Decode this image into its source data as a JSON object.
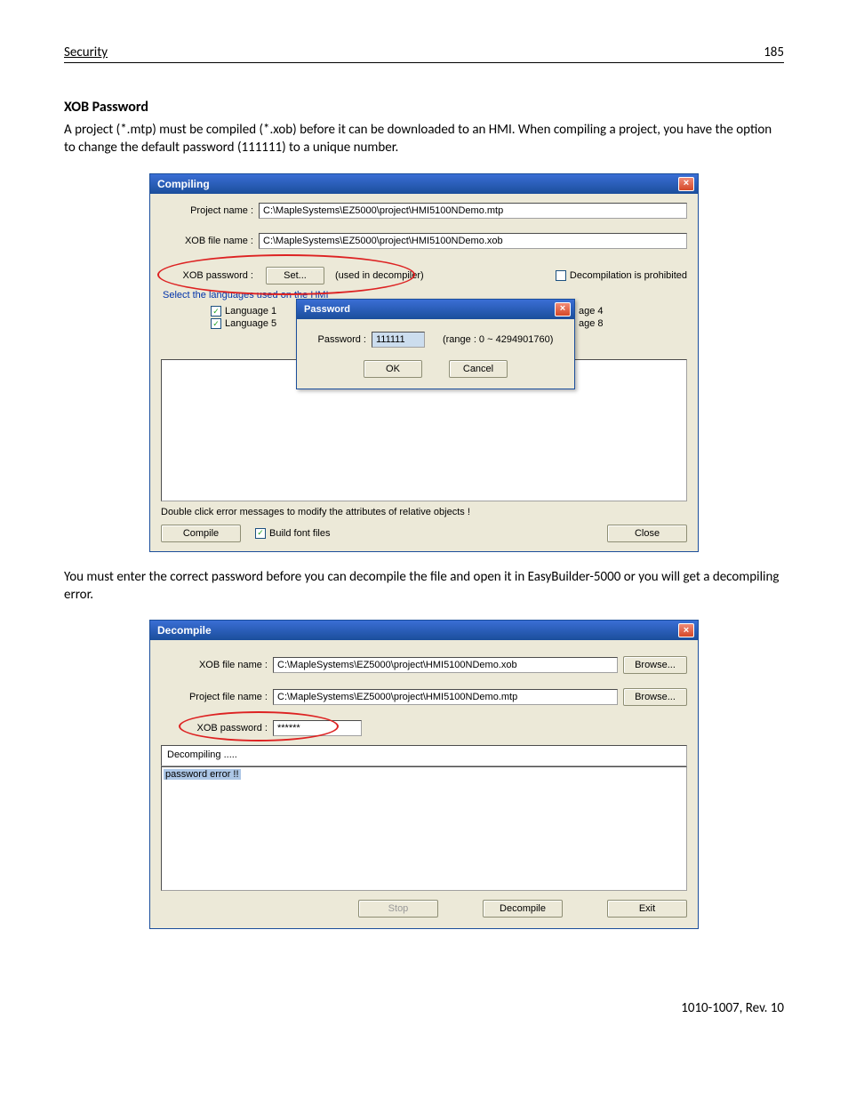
{
  "header": {
    "left": "Security",
    "right": "185"
  },
  "section_title": "XOB Password",
  "para1": "A project (*.mtp) must be compiled (*.xob) before it can be downloaded to an HMI. When compiling a project, you have the option to change the default password (111111) to a unique number.",
  "compiling": {
    "title": "Compiling",
    "project_label": "Project name :",
    "project_value": "C:\\MapleSystems\\EZ5000\\project\\HMI5100NDemo.mtp",
    "xob_label": "XOB file name :",
    "xob_value": "C:\\MapleSystems\\EZ5000\\project\\HMI5100NDemo.xob",
    "pw_label": "XOB password :",
    "set_btn": "Set...",
    "used_note": "(used in decompiler)",
    "prohibit_label": "Decompilation is prohibited",
    "lang_section": "Select the languages used on the HMI",
    "lang1": "Language 1",
    "lang5": "Language 5",
    "lang4_tail": "age 4",
    "lang8_tail": "age 8",
    "dblclick_note": "Double click error messages to modify the attributes of relative objects !",
    "compile_btn": "Compile",
    "build_fonts": "Build font files",
    "close_btn": "Close",
    "pw_dialog": {
      "title": "Password",
      "pw_label": "Password :",
      "pw_value": "111111",
      "range_note": "(range : 0 ~ 4294901760)",
      "ok": "OK",
      "cancel": "Cancel"
    }
  },
  "para2": "You must enter the correct password before you can decompile the file and open it in EasyBuilder-5000 or you will get a decompiling error.",
  "decompile": {
    "title": "Decompile",
    "xob_label": "XOB file name :",
    "xob_value": "C:\\MapleSystems\\EZ5000\\project\\HMI5100NDemo.xob",
    "proj_label": "Project file name :",
    "proj_value": "C:\\MapleSystems\\EZ5000\\project\\HMI5100NDemo.mtp",
    "pw_label": "XOB password :",
    "pw_value": "******",
    "browse": "Browse...",
    "status": "Decompiling .....",
    "error": "password error !!",
    "stop": "Stop",
    "decompile_btn": "Decompile",
    "exit": "Exit"
  },
  "footer": "1010-1007, Rev. 10"
}
